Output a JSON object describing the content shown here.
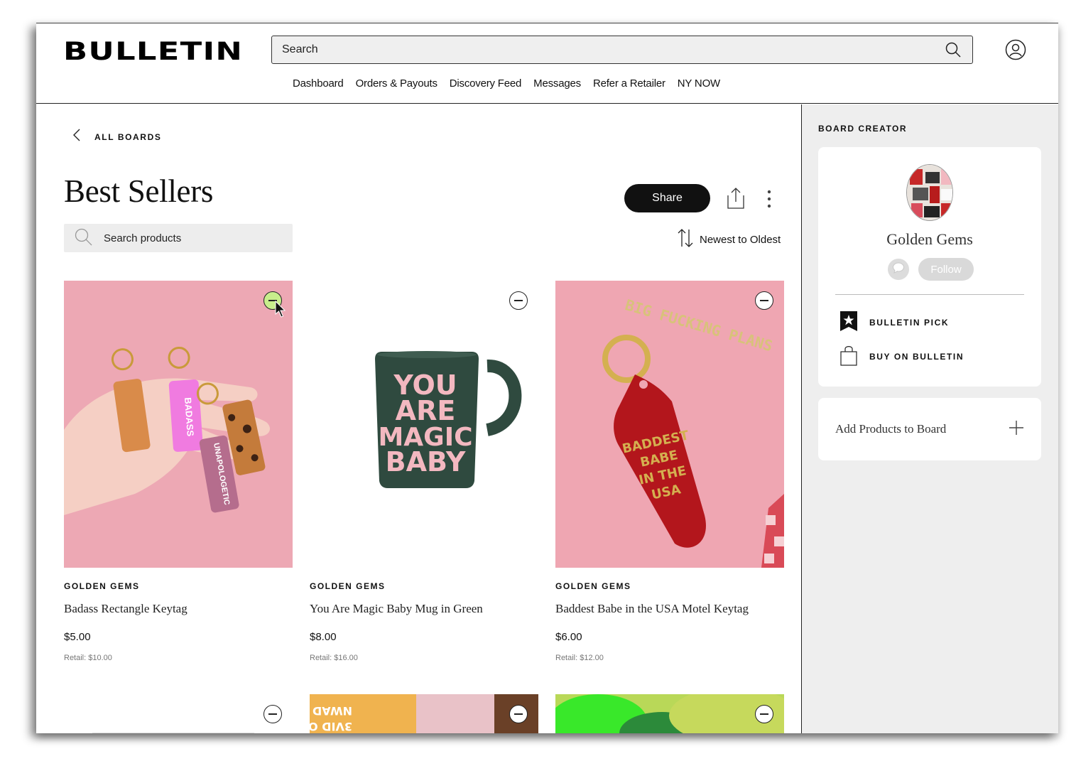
{
  "header": {
    "logo": "BULLETIN",
    "search_placeholder": "Search",
    "nav": [
      "Dashboard",
      "Orders & Payouts",
      "Discovery Feed",
      "Messages",
      "Refer a Retailer",
      "NY NOW"
    ]
  },
  "board": {
    "back_label": "ALL BOARDS",
    "title": "Best Sellers",
    "share_label": "Share",
    "search_placeholder": "Search products",
    "sort_label": "Newest to Oldest"
  },
  "products": [
    {
      "brand": "GOLDEN GEMS",
      "name": "Badass Rectangle Keytag",
      "price": "$5.00",
      "retail": "Retail: $10.00"
    },
    {
      "brand": "GOLDEN GEMS",
      "name": "You Are Magic Baby Mug in Green",
      "price": "$8.00",
      "retail": "Retail: $16.00"
    },
    {
      "brand": "GOLDEN GEMS",
      "name": "Baddest Babe in the USA Motel Keytag",
      "price": "$6.00",
      "retail": "Retail: $12.00"
    }
  ],
  "product_images": {
    "mug_text": [
      "YOU",
      "ARE",
      "MAGIC",
      "BABY"
    ],
    "keytag_text": [
      "BADDEST",
      "BABE",
      "IN THE",
      "USA"
    ],
    "card_text": "BIG FUCKING PLANS",
    "tag_labels": [
      "BADASS",
      "UNAPOLOGETIC"
    ],
    "next_row_text": [
      "NWAD",
      "3VID O"
    ]
  },
  "sidebar": {
    "title": "BOARD CREATOR",
    "creator_name": "Golden Gems",
    "follow_label": "Follow",
    "bulletin_pick": "BULLETIN PICK",
    "buy_on_bulletin": "BUY ON BULLETIN",
    "add_products": "Add Products to Board"
  },
  "colors": {
    "accent": "#111111",
    "pink_bg": "#f0a7b4",
    "remove_hover": "#c8ee8c",
    "mug_green": "#2f4a3f"
  }
}
